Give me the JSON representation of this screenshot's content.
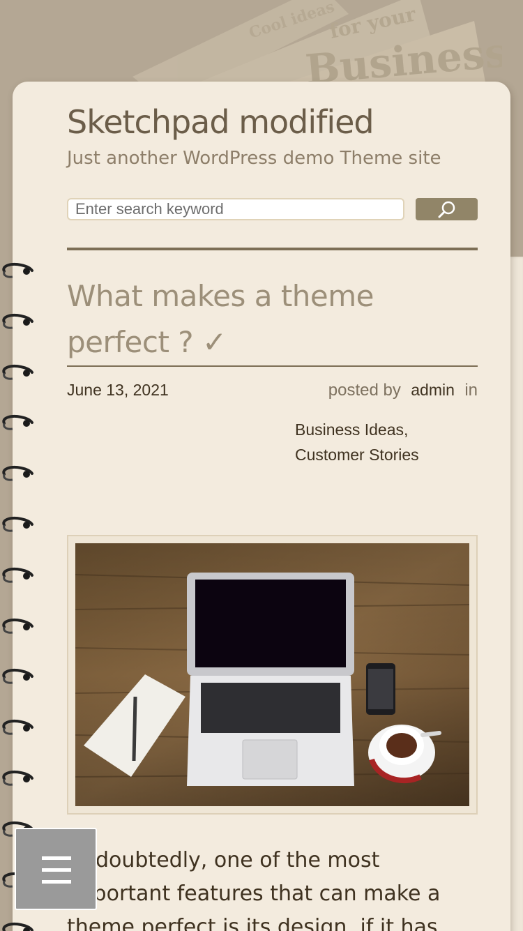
{
  "site": {
    "title": "Sketchpad modified",
    "tagline": "Just another WordPress demo Theme site"
  },
  "background": {
    "newspaper_words": [
      "Cool ideas",
      "for your",
      "Business"
    ]
  },
  "search": {
    "placeholder": "Enter search keyword",
    "button_icon": "search-icon"
  },
  "post": {
    "title": "What makes a theme perfect ? ✓",
    "date": "June 13, 2021",
    "posted_by_label": "posted by",
    "author": "admin",
    "in_label": "in",
    "categories": [
      "Business Ideas,",
      "Customer Stories"
    ],
    "featured_image": "laptop-on-wooden-desk-photo",
    "excerpt": "Undoubtedly, one of the most important features that can make a theme perfect is its design, if it has"
  },
  "menu": {
    "icon": "hamburger-icon"
  },
  "colors": {
    "page_background": "#b4a794",
    "paper": "#f3ebde",
    "title": "#6b5d49",
    "accent": "#918568",
    "text": "#3f3220"
  }
}
